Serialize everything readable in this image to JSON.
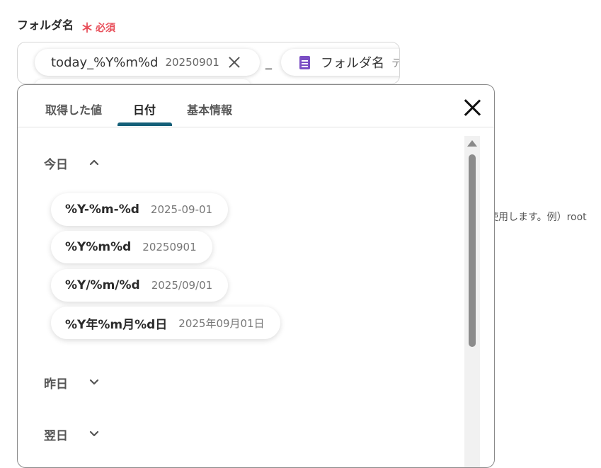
{
  "field": {
    "label": "フォルダ名",
    "required_mark": "＊",
    "required_text": "必須"
  },
  "input": {
    "chip1": {
      "title": "today_%Y%m%d",
      "value": "20250901"
    },
    "separator": "_",
    "chip2": {
      "title": "フォルダ名",
      "value": "テ",
      "icon": "google-docs-icon"
    }
  },
  "background_hint": "使用します。例）root",
  "panel": {
    "tabs": [
      {
        "label": "取得した値"
      },
      {
        "label": "日付"
      },
      {
        "label": "基本情報"
      }
    ],
    "active_tab": "日付",
    "sections": {
      "today": {
        "label": "今日",
        "expanded": true,
        "formats": [
          {
            "key": "%Y-%m-%d",
            "sample": "2025-09-01"
          },
          {
            "key": "%Y%m%d",
            "sample": "20250901"
          },
          {
            "key": "%Y/%m/%d",
            "sample": "2025/09/01"
          },
          {
            "key": "%Y年%m月%d日",
            "sample": "2025年09月01日"
          }
        ]
      },
      "yesterday": {
        "label": "昨日",
        "expanded": false
      },
      "tomorrow": {
        "label": "翌日",
        "expanded": false
      }
    }
  },
  "colors": {
    "required": "#e8505b",
    "tab_underline": "#145f78",
    "doc_icon": "#7b4fc4"
  }
}
